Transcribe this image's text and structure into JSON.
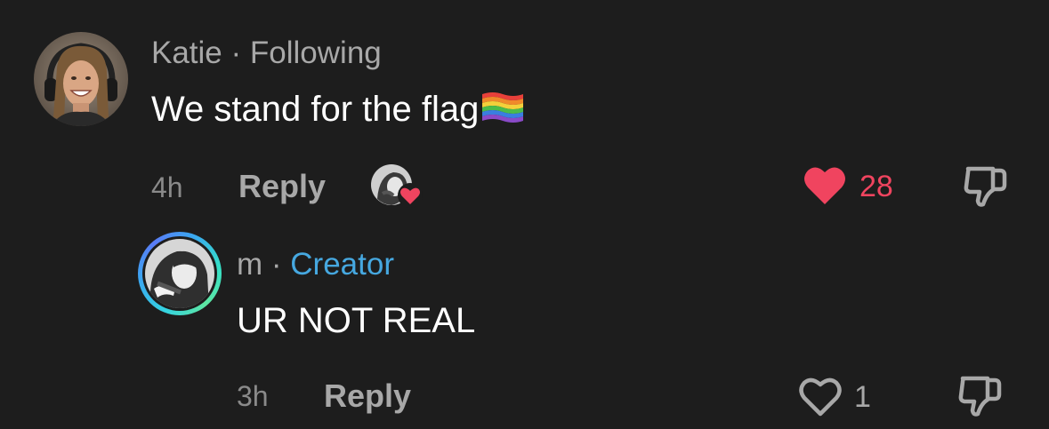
{
  "comment": {
    "author": "Katie",
    "separator": "·",
    "relation": "Following",
    "text": "We stand for the flag",
    "flag_icon": "rainbow-flag-icon",
    "time": "4h",
    "reply_label": "Reply",
    "likes": "28",
    "liked": true,
    "like_color": "#f0445f"
  },
  "reply": {
    "author": "m",
    "separator": "·",
    "badge": "Creator",
    "badge_color": "#46a8e0",
    "ring_colors": [
      "#35d4e0",
      "#5a7cf7",
      "#5ee6a2"
    ],
    "text": "UR NOT REAL",
    "time": "3h",
    "reply_label": "Reply",
    "likes": "1",
    "liked": false
  },
  "icons": {
    "like": "heart-icon",
    "dislike": "thumbs-down-icon",
    "creator_liked": "creator-liked-avatar-icon"
  }
}
